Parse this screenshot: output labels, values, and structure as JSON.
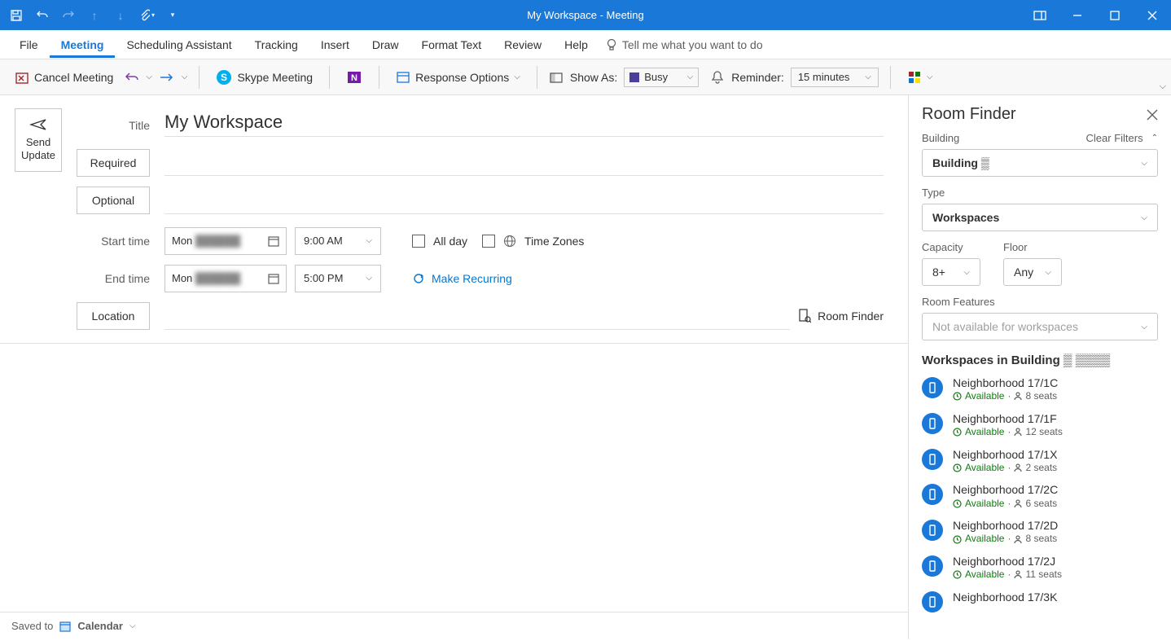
{
  "window": {
    "title": "My Workspace - Meeting"
  },
  "menubar": {
    "items": [
      "File",
      "Meeting",
      "Scheduling Assistant",
      "Tracking",
      "Insert",
      "Draw",
      "Format Text",
      "Review",
      "Help"
    ],
    "active": "Meeting",
    "tellme": "Tell me what you want to do"
  },
  "ribbon": {
    "cancel": "Cancel Meeting",
    "skype": "Skype Meeting",
    "response": "Response Options",
    "showas_label": "Show As:",
    "showas_value": "Busy",
    "reminder_label": "Reminder:",
    "reminder_value": "15 minutes"
  },
  "form": {
    "send": "Send Update",
    "label_title": "Title",
    "title": "My Workspace",
    "required": "Required",
    "optional": "Optional",
    "start_label": "Start time",
    "end_label": "End time",
    "start_day": "Mon",
    "start_date": "██████",
    "start_time": "9:00 AM",
    "end_day": "Mon",
    "end_date": "██████",
    "end_time": "5:00 PM",
    "allday": "All day",
    "timezones": "Time Zones",
    "recurring": "Make Recurring",
    "location": "Location",
    "roomfinder": "Room Finder"
  },
  "status": {
    "saved": "Saved to",
    "calendar": "Calendar"
  },
  "panel": {
    "title": "Room Finder",
    "building_label": "Building",
    "clear": "Clear Filters",
    "building_value": "Building ▒",
    "type_label": "Type",
    "type_value": "Workspaces",
    "capacity_label": "Capacity",
    "capacity_value": "8+",
    "floor_label": "Floor",
    "floor_value": "Any",
    "features_label": "Room Features",
    "features_value": "Not available for workspaces",
    "list_header": "Workspaces in Building ▒ ▒▒▒▒",
    "items": [
      {
        "name": "Neighborhood 17/1C",
        "status": "Available",
        "seats": "8 seats"
      },
      {
        "name": "Neighborhood 17/1F",
        "status": "Available",
        "seats": "12 seats"
      },
      {
        "name": "Neighborhood 17/1X",
        "status": "Available",
        "seats": "2 seats"
      },
      {
        "name": "Neighborhood 17/2C",
        "status": "Available",
        "seats": "6 seats"
      },
      {
        "name": "Neighborhood 17/2D",
        "status": "Available",
        "seats": "8 seats"
      },
      {
        "name": "Neighborhood 17/2J",
        "status": "Available",
        "seats": "11 seats"
      },
      {
        "name": "Neighborhood 17/3K",
        "status": "",
        "seats": ""
      }
    ]
  }
}
